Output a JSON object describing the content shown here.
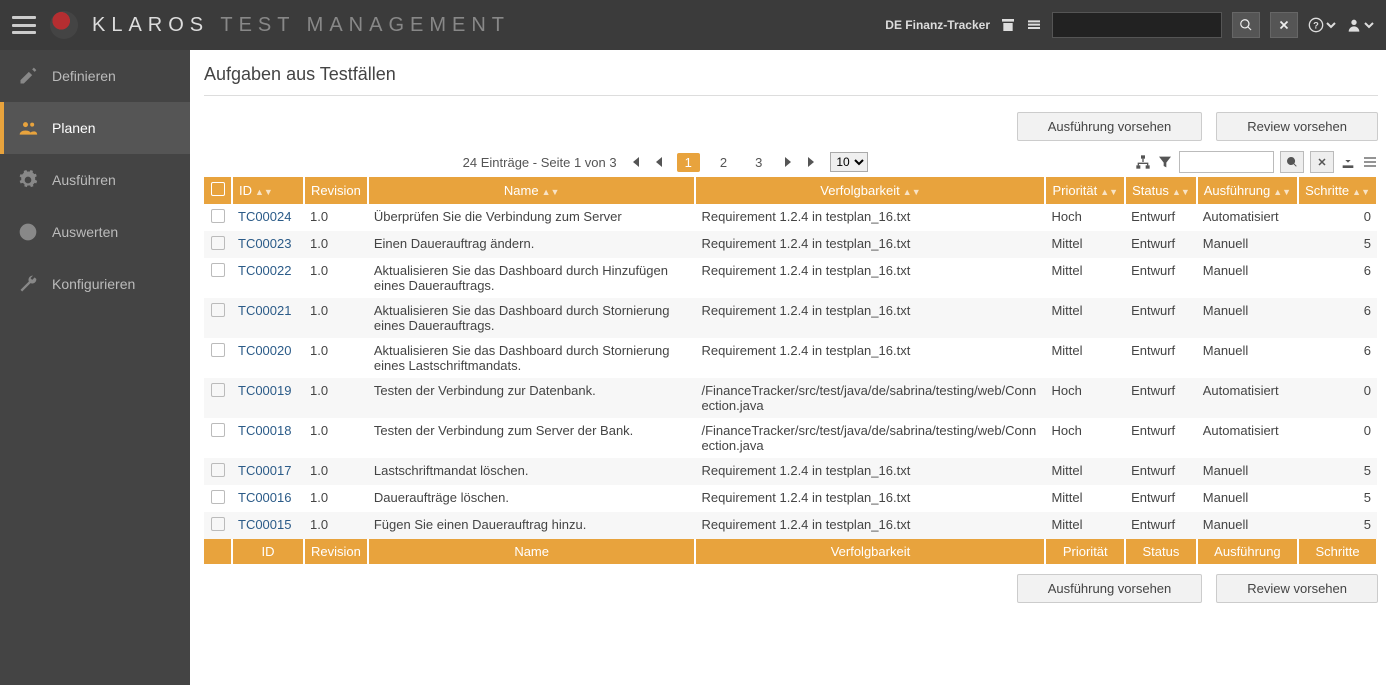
{
  "brand": {
    "name": "KLAROS",
    "sub": "TEST MANAGEMENT"
  },
  "topbar": {
    "project_label": "DE Finanz-Tracker"
  },
  "sidebar": {
    "items": [
      {
        "label": "Definieren"
      },
      {
        "label": "Planen"
      },
      {
        "label": "Ausführen"
      },
      {
        "label": "Auswerten"
      },
      {
        "label": "Konfigurieren"
      }
    ]
  },
  "page": {
    "title": "Aufgaben aus Testfällen"
  },
  "actions": {
    "execute": "Ausführung vorsehen",
    "review": "Review vorsehen"
  },
  "pager": {
    "summary": "24 Einträge - Seite 1 von 3",
    "pages": [
      "1",
      "2",
      "3"
    ],
    "per_page_options": [
      "10"
    ],
    "per_page": "10"
  },
  "columns": {
    "id": "ID",
    "revision": "Revision",
    "name": "Name",
    "trace": "Verfolgbarkeit",
    "priority": "Priorität",
    "status": "Status",
    "execution": "Ausführung",
    "steps": "Schritte"
  },
  "rows": [
    {
      "id": "TC00024",
      "rev": "1.0",
      "name": "Überprüfen Sie die Verbindung zum Server",
      "trace": "Requirement 1.2.4 in testplan_16.txt",
      "prio": "Hoch",
      "status": "Entwurf",
      "exec": "Automatisiert",
      "steps": "0"
    },
    {
      "id": "TC00023",
      "rev": "1.0",
      "name": "Einen Dauerauftrag ändern.",
      "trace": "Requirement 1.2.4 in testplan_16.txt",
      "prio": "Mittel",
      "status": "Entwurf",
      "exec": "Manuell",
      "steps": "5"
    },
    {
      "id": "TC00022",
      "rev": "1.0",
      "name": "Aktualisieren Sie das Dashboard durch Hinzufügen eines Dauerauftrags.",
      "trace": "Requirement 1.2.4 in testplan_16.txt",
      "prio": "Mittel",
      "status": "Entwurf",
      "exec": "Manuell",
      "steps": "6"
    },
    {
      "id": "TC00021",
      "rev": "1.0",
      "name": "Aktualisieren Sie das Dashboard durch Stornierung eines Dauerauftrags.",
      "trace": "Requirement 1.2.4 in testplan_16.txt",
      "prio": "Mittel",
      "status": "Entwurf",
      "exec": "Manuell",
      "steps": "6"
    },
    {
      "id": "TC00020",
      "rev": "1.0",
      "name": "Aktualisieren Sie das Dashboard durch Stornierung eines Lastschriftmandats.",
      "trace": "Requirement 1.2.4 in testplan_16.txt",
      "prio": "Mittel",
      "status": "Entwurf",
      "exec": "Manuell",
      "steps": "6"
    },
    {
      "id": "TC00019",
      "rev": "1.0",
      "name": "Testen der Verbindung zur Datenbank.",
      "trace": "/FinanceTracker/src/test/java/de/sabrina/testing/web/Connection.java",
      "prio": "Hoch",
      "status": "Entwurf",
      "exec": "Automatisiert",
      "steps": "0"
    },
    {
      "id": "TC00018",
      "rev": "1.0",
      "name": "Testen der Verbindung zum Server der Bank.",
      "trace": "/FinanceTracker/src/test/java/de/sabrina/testing/web/Connection.java",
      "prio": "Hoch",
      "status": "Entwurf",
      "exec": "Automatisiert",
      "steps": "0"
    },
    {
      "id": "TC00017",
      "rev": "1.0",
      "name": "Lastschriftmandat löschen.",
      "trace": "Requirement 1.2.4 in testplan_16.txt",
      "prio": "Mittel",
      "status": "Entwurf",
      "exec": "Manuell",
      "steps": "5"
    },
    {
      "id": "TC00016",
      "rev": "1.0",
      "name": "Daueraufträge löschen.",
      "trace": "Requirement 1.2.4 in testplan_16.txt",
      "prio": "Mittel",
      "status": "Entwurf",
      "exec": "Manuell",
      "steps": "5"
    },
    {
      "id": "TC00015",
      "rev": "1.0",
      "name": "Fügen Sie einen Dauerauftrag hinzu.",
      "trace": "Requirement 1.2.4 in testplan_16.txt",
      "prio": "Mittel",
      "status": "Entwurf",
      "exec": "Manuell",
      "steps": "5"
    }
  ]
}
